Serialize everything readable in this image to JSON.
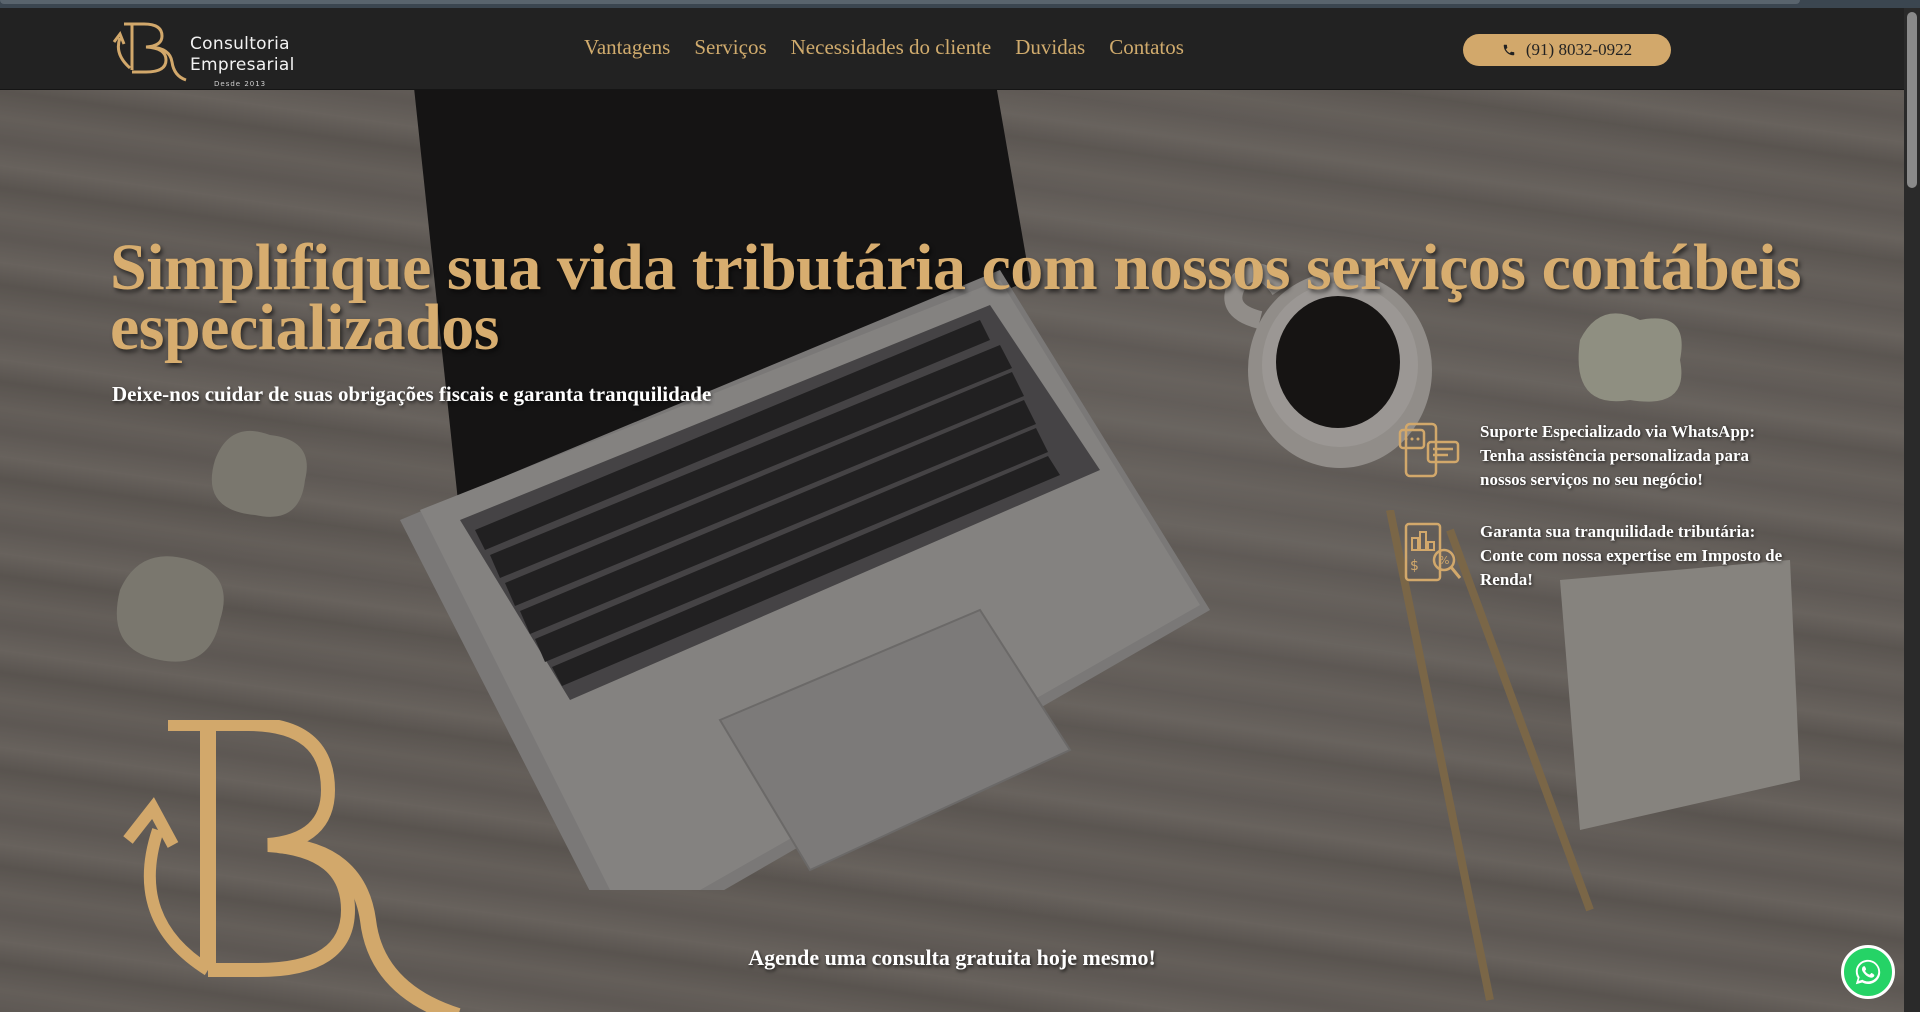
{
  "header": {
    "logo_line1": "Consultoria",
    "logo_line2": "Empresarial",
    "logo_since": "Desde 2013",
    "nav": [
      "Vantagens",
      "Serviços",
      "Necessidades do cliente",
      "Duvidas",
      "Contatos"
    ],
    "phone": "(91) 8032-0922",
    "phone_icon": "phone-icon"
  },
  "hero": {
    "title": "Simplifique sua vida tributária com nossos serviços contábeis especializados",
    "subtitle": "Deixe-nos cuidar de suas obrigações fiscais e garanta tranquilidade",
    "features": [
      {
        "icon": "whatsapp-support-icon",
        "text": "Suporte Especializado via WhatsApp: Tenha assistência personalizada para nossos serviços no seu negócio!"
      },
      {
        "icon": "tax-document-icon",
        "text": "Garanta sua tranquilidade tributária: Conte com nossa expertise em Imposto de Renda!"
      }
    ],
    "cta": "Agende uma consulta gratuita hoje mesmo!"
  },
  "colors": {
    "gold": "#d7ad6f",
    "header_bg": "#222222",
    "whatsapp_green": "#25d366"
  }
}
